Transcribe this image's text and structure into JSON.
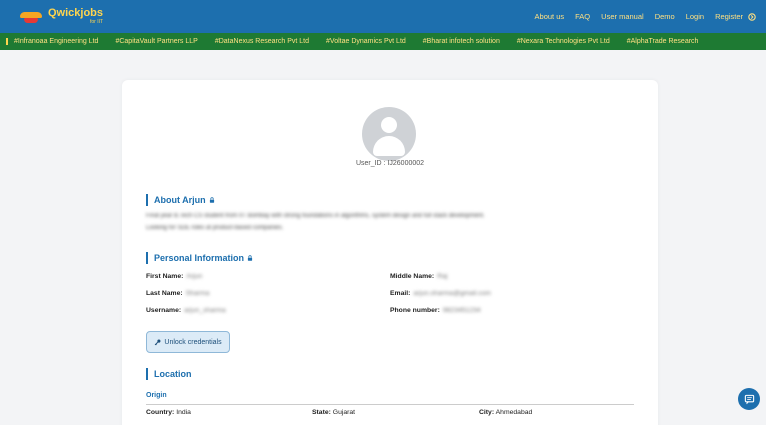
{
  "brand": {
    "name": "Qwickjobs",
    "tagline": "for IIT"
  },
  "nav": {
    "links": [
      "About us",
      "FAQ",
      "User manual",
      "Demo",
      "Login",
      "Register"
    ]
  },
  "ticker": [
    "#Infranoaa Engineering Ltd",
    "#CapitaVault Partners LLP",
    "#DataNexus Research Pvt Ltd",
    "#Voltae Dynamics Pvt Ltd",
    "#Bharat infotech solution",
    "#Nexara Technologies Pvt Ltd",
    "#AlphaTrade Research"
  ],
  "profile": {
    "user_id": "User_ID : IJ26000002",
    "about_title": "About Arjun",
    "about_text_line1": "Final year B.Tech CS student from IIT Bombay with strong foundations in algorithms, system design and full stack development.",
    "about_text_line2": "Looking for SDE roles at product-based companies."
  },
  "personal": {
    "title": "Personal Information",
    "first_name_label": "First Name:",
    "first_name": "Arjun",
    "middle_name_label": "Middle Name:",
    "middle_name": "Raj",
    "last_name_label": "Last Name:",
    "last_name": "Sharma",
    "email_label": "Email:",
    "email": "arjun.sharma@gmail.com",
    "username_label": "Username:",
    "username": "arjun_sharma",
    "phone_label": "Phone number:",
    "phone": "9823451234"
  },
  "unlock_button": "Unlock credentials",
  "location": {
    "title": "Location",
    "origin_label": "Origin",
    "country_label": "Country:",
    "country": "India",
    "state_label": "State:",
    "state": "Gujarat",
    "city_label": "City:",
    "city": "Ahmedabad"
  },
  "colors": {
    "primary": "#1d6fae",
    "ticker_bg": "#1e7a33",
    "accent_text": "#ffe082",
    "page_bg": "#f3f4f6"
  },
  "icons": {
    "logo": "qwickjobs-logo",
    "login": "login-icon",
    "lock": "lock-icon",
    "key": "key-icon",
    "chat": "chat-icon"
  }
}
